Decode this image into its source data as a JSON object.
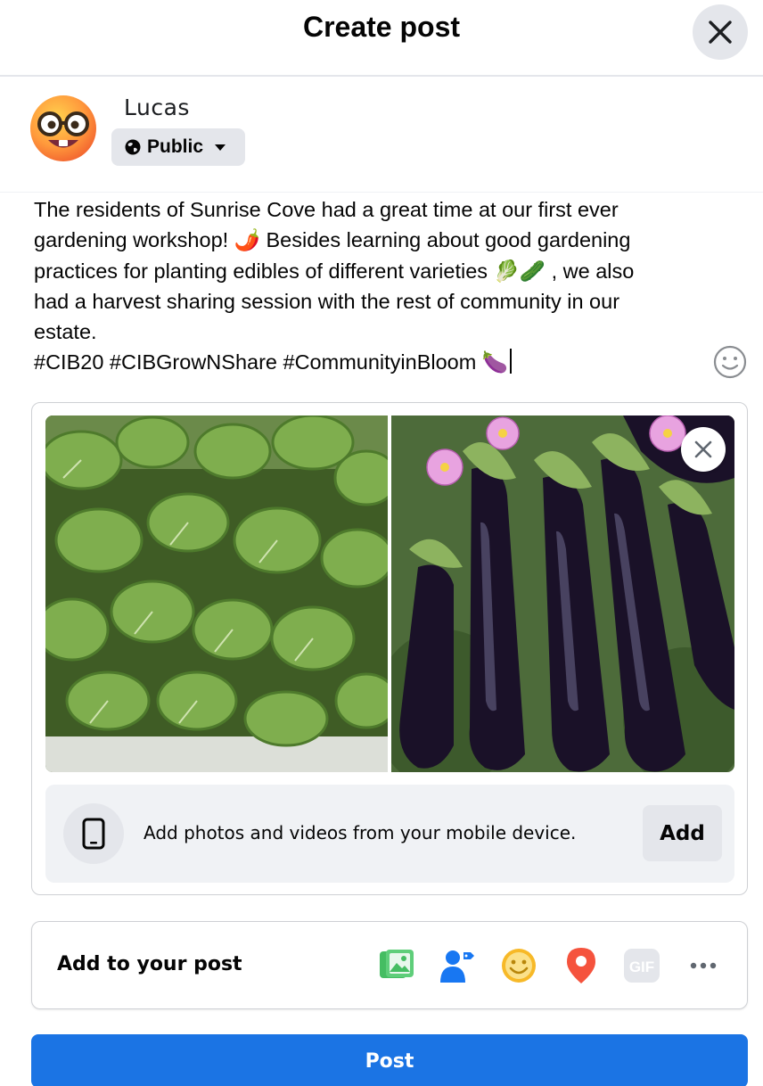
{
  "header": {
    "title": "Create post"
  },
  "user": {
    "name": "Lucas",
    "audience": "Public"
  },
  "post": {
    "lines": [
      "The residents of Sunrise Cove had a great time at our first ever",
      "gardening workshop! 🌶️ Besides learning about good gardening",
      "practices for planting edibles of different varieties 🥬🥒 , we also",
      "had a harvest sharing session with the rest of community in our",
      "estate.",
      "#CIB20 #CIBGrowNShare #CommunityinBloom 🍆"
    ]
  },
  "media": {
    "photos": [
      "pak choi seedlings",
      "eggplants with flowers"
    ],
    "mobile_prompt": "Add photos and videos from your mobile device.",
    "add_label": "Add"
  },
  "add_to_post": {
    "label": "Add to your post",
    "tools": [
      "photo-video-icon",
      "tag-people-icon",
      "feeling-activity-icon",
      "check-in-icon",
      "gif-icon",
      "more-icon"
    ],
    "colors": {
      "photo": "#45bd62",
      "tag": "#1877f2",
      "feeling": "#f7b928",
      "checkin": "#f5533d",
      "gif_disabled": "#e4e6eb"
    }
  },
  "actions": {
    "post_label": "Post",
    "post_color": "#1b74e4"
  }
}
